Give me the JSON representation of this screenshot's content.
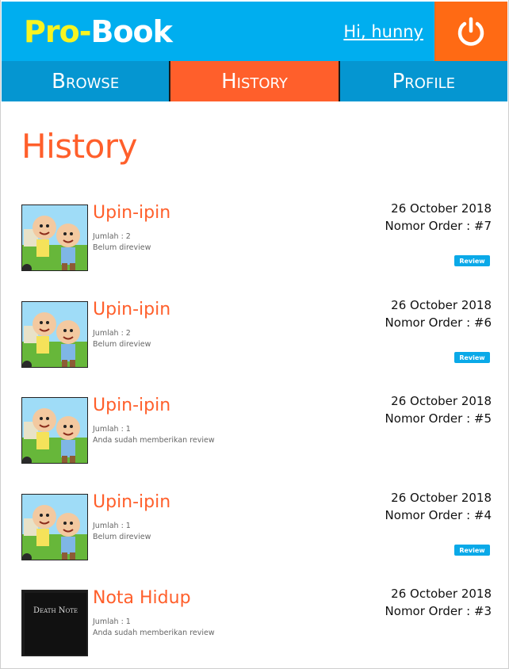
{
  "header": {
    "brand_pro": "Pro",
    "brand_dash": "-",
    "brand_book": "Book",
    "greeting": "Hi, hunny",
    "logout_icon": "power-icon"
  },
  "nav": {
    "tabs": [
      {
        "label": "Browse",
        "active": false
      },
      {
        "label": "History",
        "active": true
      },
      {
        "label": "Profile",
        "active": false
      }
    ]
  },
  "page": {
    "title": "History"
  },
  "orders": [
    {
      "title": "Upin-ipin",
      "qty": "Jumlah : 2",
      "review_state": "Belum direview",
      "date": "26 October 2018",
      "order_no": "Nomor Order : #7",
      "review_label": "Review",
      "cover": "upin-ipin-cover"
    },
    {
      "title": "Upin-ipin",
      "qty": "Jumlah : 2",
      "review_state": "Belum direview",
      "date": "26 October 2018",
      "order_no": "Nomor Order : #6",
      "review_label": "Review",
      "cover": "upin-ipin-cover"
    },
    {
      "title": "Upin-ipin",
      "qty": "Jumlah : 1",
      "review_state": "Anda sudah memberikan review",
      "date": "26 October 2018",
      "order_no": "Nomor Order : #5",
      "review_label": "",
      "cover": "upin-ipin-cover"
    },
    {
      "title": "Upin-ipin",
      "qty": "Jumlah : 1",
      "review_state": "Belum direview",
      "date": "26 October 2018",
      "order_no": "Nomor Order : #4",
      "review_label": "Review",
      "cover": "upin-ipin-cover"
    },
    {
      "title": "Nota Hidup",
      "qty": "Jumlah : 1",
      "review_state": "Anda sudah memberikan review",
      "date": "26 October 2018",
      "order_no": "Nomor Order : #3",
      "review_label": "",
      "cover": "death-note-cover",
      "cover_text": "Death Note"
    }
  ],
  "colors": {
    "header_bg": "#00aeef",
    "nav_bg": "#0596d1",
    "accent": "#ff5f2b",
    "logout_bg": "#ff6a14",
    "brand_yellow": "#f7f421",
    "review_button": "#0aa9e8"
  }
}
